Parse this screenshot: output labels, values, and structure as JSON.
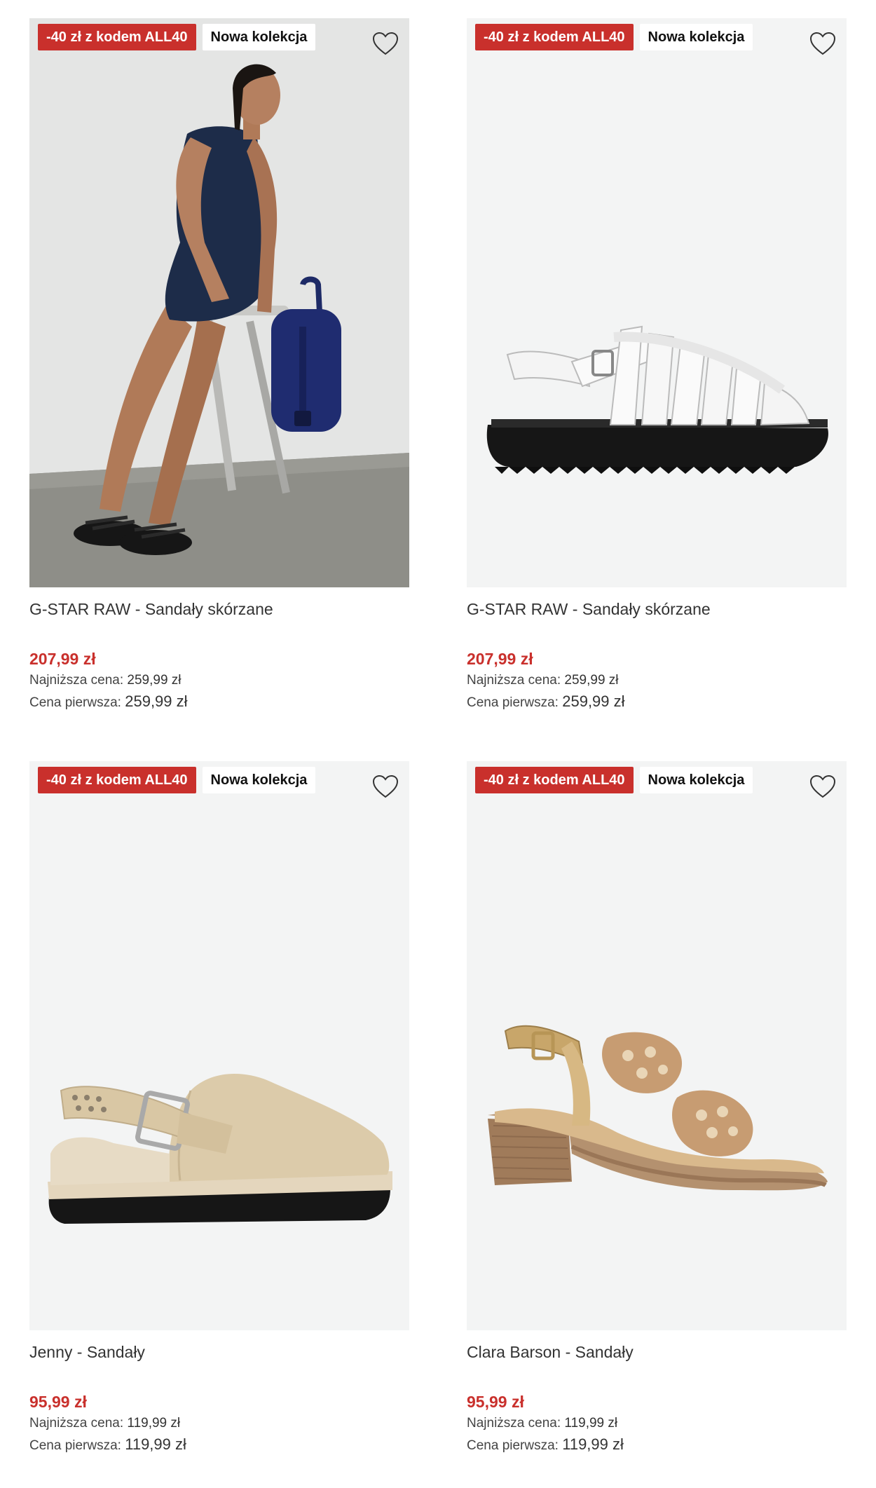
{
  "products": [
    {
      "promo_badge": "-40 zł z kodem ALL40",
      "new_badge": "Nowa kolekcja",
      "title": "G-STAR RAW - Sandały skórzane",
      "price": "207,99 zł",
      "lowest_label": "Najniższa cena:",
      "lowest_value": "259,99 zł",
      "original_label": "Cena pierwsza:",
      "original_value": "259,99 zł",
      "image": "model-photo"
    },
    {
      "promo_badge": "-40 zł z kodem ALL40",
      "new_badge": "Nowa kolekcja",
      "title": "G-STAR RAW - Sandały skórzane",
      "price": "207,99 zł",
      "lowest_label": "Najniższa cena:",
      "lowest_value": "259,99 zł",
      "original_label": "Cena pierwsza:",
      "original_value": "259,99 zł",
      "image": "white-fisherman-sandal"
    },
    {
      "promo_badge": "-40 zł z kodem ALL40",
      "new_badge": "Nowa kolekcja",
      "title": "Jenny - Sandały",
      "price": "95,99 zł",
      "lowest_label": "Najniższa cena:",
      "lowest_value": "119,99 zł",
      "original_label": "Cena pierwsza:",
      "original_value": "119,99 zł",
      "image": "beige-clog-sandal"
    },
    {
      "promo_badge": "-40 zł z kodem ALL40",
      "new_badge": "Nowa kolekcja",
      "title": "Clara Barson - Sandały",
      "price": "95,99 zł",
      "lowest_label": "Najniższa cena:",
      "lowest_value": "119,99 zł",
      "original_label": "Cena pierwsza:",
      "original_value": "119,99 zł",
      "image": "tan-heeled-sandal"
    }
  ],
  "colors": {
    "promo_red": "#c9302c",
    "price_red": "#c9302c",
    "image_bg": "#f3f4f4"
  },
  "icons": {
    "wishlist": "heart-outline-icon"
  }
}
